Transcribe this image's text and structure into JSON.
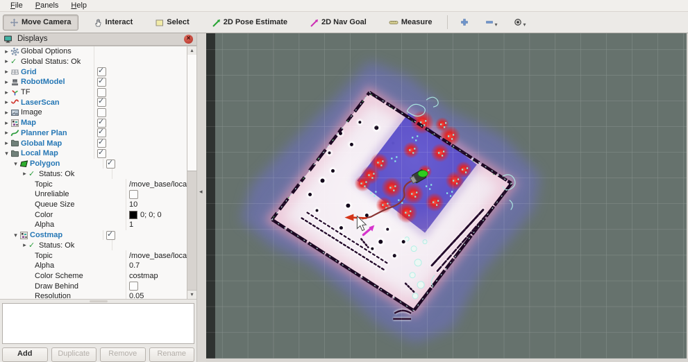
{
  "menu_bar": {
    "items": [
      {
        "label": "File"
      },
      {
        "label": "Panels"
      },
      {
        "label": "Help"
      }
    ]
  },
  "toolbar": {
    "buttons": [
      {
        "label": "Move Camera",
        "icon": "move-camera-icon",
        "active": true
      },
      {
        "label": "Interact",
        "icon": "interact-hand-icon",
        "active": false
      },
      {
        "label": "Select",
        "icon": "select-box-icon",
        "active": false
      },
      {
        "label": "2D Pose Estimate",
        "icon": "pose-estimate-arrow-icon",
        "active": false
      },
      {
        "label": "2D Nav Goal",
        "icon": "nav-goal-arrow-icon",
        "active": false
      },
      {
        "label": "Measure",
        "icon": "measure-ruler-icon",
        "active": false
      }
    ],
    "extra_buttons": [
      {
        "icon": "zoom-in-plus-icon",
        "dropdown": false
      },
      {
        "icon": "zoom-out-minus-icon",
        "dropdown": true
      },
      {
        "icon": "camera-focus-icon",
        "dropdown": true
      }
    ]
  },
  "displays_panel": {
    "title": "Displays",
    "tree": [
      {
        "indent": 0,
        "expander": "closed",
        "icon": "gear",
        "label": "Global Options",
        "emphasized": false,
        "value": null
      },
      {
        "indent": 0,
        "expander": "closed",
        "icon": "check",
        "label": "Global Status: Ok",
        "emphasized": false,
        "value": null
      },
      {
        "indent": 0,
        "expander": "closed",
        "icon": "grid",
        "label": "Grid",
        "emphasized": true,
        "value": {
          "type": "checkbox",
          "checked": true
        }
      },
      {
        "indent": 0,
        "expander": "closed",
        "icon": "robot",
        "label": "RobotModel",
        "emphasized": true,
        "value": {
          "type": "checkbox",
          "checked": true
        }
      },
      {
        "indent": 0,
        "expander": "closed",
        "icon": "tf",
        "label": "TF",
        "emphasized": false,
        "value": {
          "type": "checkbox",
          "checked": false
        }
      },
      {
        "indent": 0,
        "expander": "closed",
        "icon": "laser",
        "label": "LaserScan",
        "emphasized": true,
        "value": {
          "type": "checkbox",
          "checked": true
        }
      },
      {
        "indent": 0,
        "expander": "closed",
        "icon": "image",
        "label": "Image",
        "emphasized": false,
        "value": {
          "type": "checkbox",
          "checked": false
        }
      },
      {
        "indent": 0,
        "expander": "closed",
        "icon": "map",
        "label": "Map",
        "emphasized": true,
        "value": {
          "type": "checkbox",
          "checked": true
        }
      },
      {
        "indent": 0,
        "expander": "closed",
        "icon": "path",
        "label": "Planner Plan",
        "emphasized": true,
        "value": {
          "type": "checkbox",
          "checked": true
        }
      },
      {
        "indent": 0,
        "expander": "closed",
        "icon": "folder",
        "label": "Global Map",
        "emphasized": true,
        "value": {
          "type": "checkbox",
          "checked": true
        }
      },
      {
        "indent": 0,
        "expander": "open",
        "icon": "folder",
        "label": "Local Map",
        "emphasized": true,
        "value": {
          "type": "checkbox",
          "checked": true
        }
      },
      {
        "indent": 1,
        "expander": "open",
        "icon": "polygon",
        "label": "Polygon",
        "emphasized": true,
        "value": {
          "type": "checkbox",
          "checked": true
        }
      },
      {
        "indent": 2,
        "expander": "closed",
        "icon": "check",
        "label": "Status: Ok",
        "emphasized": false,
        "value": null
      },
      {
        "indent": 2,
        "expander": "none",
        "icon": null,
        "label": "Topic",
        "emphasized": false,
        "value": {
          "type": "text",
          "text": "/move_base/local_co…"
        }
      },
      {
        "indent": 2,
        "expander": "none",
        "icon": null,
        "label": "Unreliable",
        "emphasized": false,
        "value": {
          "type": "checkbox",
          "checked": false
        }
      },
      {
        "indent": 2,
        "expander": "none",
        "icon": null,
        "label": "Queue Size",
        "emphasized": false,
        "value": {
          "type": "text",
          "text": "10"
        }
      },
      {
        "indent": 2,
        "expander": "none",
        "icon": null,
        "label": "Color",
        "emphasized": false,
        "value": {
          "type": "color",
          "swatch": "#000000",
          "text": "0; 0; 0"
        }
      },
      {
        "indent": 2,
        "expander": "none",
        "icon": null,
        "label": "Alpha",
        "emphasized": false,
        "value": {
          "type": "text",
          "text": "1"
        }
      },
      {
        "indent": 1,
        "expander": "open",
        "icon": "map",
        "label": "Costmap",
        "emphasized": true,
        "value": {
          "type": "checkbox",
          "checked": true
        }
      },
      {
        "indent": 2,
        "expander": "closed",
        "icon": "check",
        "label": "Status: Ok",
        "emphasized": false,
        "value": null
      },
      {
        "indent": 2,
        "expander": "none",
        "icon": null,
        "label": "Topic",
        "emphasized": false,
        "value": {
          "type": "text",
          "text": "/move_base/local_co…"
        }
      },
      {
        "indent": 2,
        "expander": "none",
        "icon": null,
        "label": "Alpha",
        "emphasized": false,
        "value": {
          "type": "text",
          "text": "0.7"
        }
      },
      {
        "indent": 2,
        "expander": "none",
        "icon": null,
        "label": "Color Scheme",
        "emphasized": false,
        "value": {
          "type": "text",
          "text": "costmap"
        }
      },
      {
        "indent": 2,
        "expander": "none",
        "icon": null,
        "label": "Draw Behind",
        "emphasized": false,
        "value": {
          "type": "checkbox",
          "checked": false
        }
      },
      {
        "indent": 2,
        "expander": "none",
        "icon": null,
        "label": "Resolution",
        "emphasized": false,
        "value": {
          "type": "text",
          "text": "0.05"
        }
      }
    ],
    "action_buttons": [
      {
        "label": "Add",
        "enabled": true
      },
      {
        "label": "Duplicate",
        "enabled": false
      },
      {
        "label": "Remove",
        "enabled": false
      },
      {
        "label": "Rename",
        "enabled": false
      }
    ]
  },
  "viewport": {
    "colors": {
      "background": "#66726d",
      "inflation": "#6a71a4",
      "map_free": "#f2e9f1",
      "wall": "#1d0823",
      "local_costmap": "#5a4ec8",
      "lethal": "#e22222",
      "laser": "#8ef2e8",
      "robot": "#2ecc1e",
      "path": "#8a3434",
      "pose_arrow": "#d43418",
      "goal_arrow": "#d633cc"
    }
  }
}
